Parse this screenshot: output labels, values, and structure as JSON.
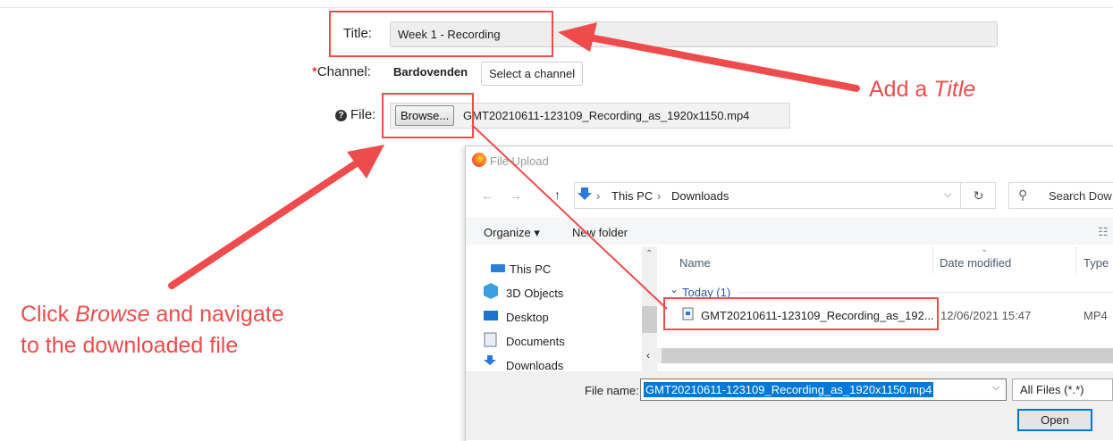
{
  "form": {
    "title_label": "Title:",
    "title_value": "Week 1 - Recording",
    "channel_required_mark": "*",
    "channel_label": "Channel:",
    "channel_value": "Bardovenden",
    "select_channel_label": "Select a channel",
    "file_help_icon": "?",
    "file_label": "File:",
    "browse_label": "Browse...",
    "file_value": "GMT20210611-123109_Recording_as_1920x1150.mp4"
  },
  "dialog": {
    "title": "File Upload",
    "nav": {
      "back": "←",
      "forward": "→",
      "up": "↑"
    },
    "breadcrumb": [
      "This PC",
      "Downloads"
    ],
    "breadcrumb_sep": "›",
    "refresh": "↻",
    "search_placeholder": "Search Dow",
    "toolbar": {
      "organize": "Organize ▾",
      "new_folder": "New folder"
    },
    "tree": [
      "This PC",
      "3D Objects",
      "Desktop",
      "Documents",
      "Downloads"
    ],
    "columns": [
      "Name",
      "Date modified",
      "Type"
    ],
    "group": "Today (1)",
    "file_row": {
      "name": "GMT20210611-123109_Recording_as_192...",
      "date": "12/06/2021 15:47",
      "type": "MP4"
    },
    "file_name_label": "File name:",
    "file_name_value": "GMT20210611-123109_Recording_as_1920x1150.mp4",
    "filter": "All Files (*.*)",
    "open_label": "Open"
  },
  "annotations": {
    "add_title_prefix": "Add a ",
    "add_title_em": "Title",
    "browse_line1_prefix": "Click ",
    "browse_line1_em": "Browse",
    "browse_line1_suffix": " and navigate",
    "browse_line2": "to the downloaded file",
    "color": "#ee4c4c"
  }
}
